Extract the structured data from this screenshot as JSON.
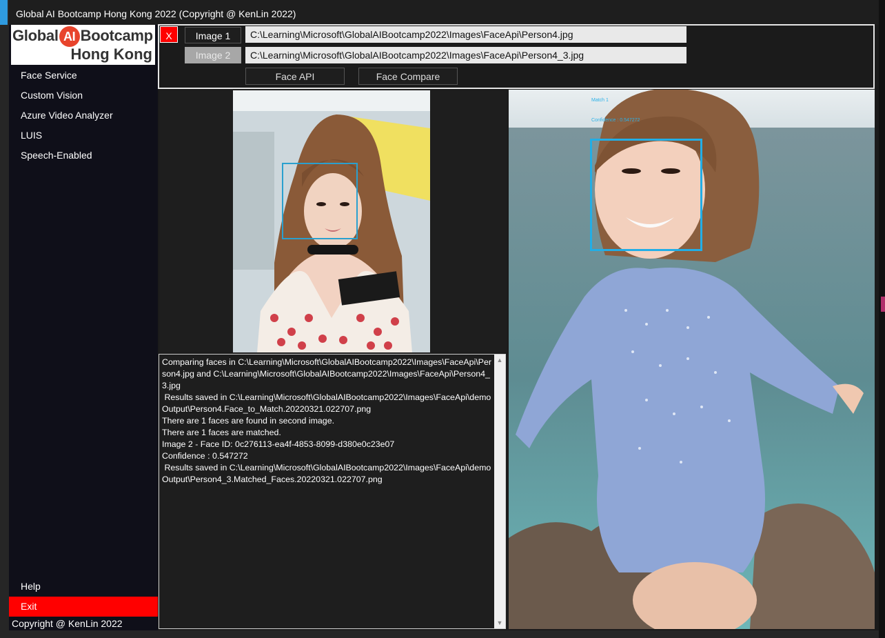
{
  "window": {
    "title": "Global AI Bootcamp Hong Kong 2022 (Copyright @ KenLin 2022)"
  },
  "logo": {
    "word1": "Global",
    "ai": "AI",
    "word2": "Bootcamp",
    "line2": "Hong Kong"
  },
  "sidebar": {
    "items": [
      {
        "label": "Face Service"
      },
      {
        "label": "Custom Vision"
      },
      {
        "label": "Azure Video Analyzer"
      },
      {
        "label": "LUIS"
      },
      {
        "label": "Speech-Enabled"
      }
    ],
    "help_label": "Help",
    "exit_label": "Exit",
    "copyright": "Copyright @ KenLin 2022"
  },
  "toolbar": {
    "close_label": "X",
    "image1_label": "Image 1",
    "image2_label": "Image 2",
    "image1_path": "C:\\Learning\\Microsoft\\GlobalAIBootcamp2022\\Images\\FaceApi\\Person4.jpg",
    "image2_path": "C:\\Learning\\Microsoft\\GlobalAIBootcamp2022\\Images\\FaceApi\\Person4_3.jpg",
    "face_api_label": "Face API",
    "face_compare_label": "Face Compare"
  },
  "result_overlay": {
    "match_label": "Match 1",
    "confidence_label": "Confidence : 0.547272"
  },
  "log": {
    "text": "Comparing faces in C:\\Learning\\Microsoft\\GlobalAIBootcamp2022\\Images\\FaceApi\\Person4.jpg and C:\\Learning\\Microsoft\\GlobalAIBootcamp2022\\Images\\FaceApi\\Person4_3.jpg\n Results saved in C:\\Learning\\Microsoft\\GlobalAIBootcamp2022\\Images\\FaceApi\\demoOutput\\Person4.Face_to_Match.20220321.022707.png\nThere are 1 faces are found in second image.\nThere are 1 faces are matched.\nImage 2 - Face ID: 0c276113-ea4f-4853-8099-d380e0c23e07\nConfidence : 0.547272\n Results saved in C:\\Learning\\Microsoft\\GlobalAIBootcamp2022\\Images\\FaceApi\\demoOutput\\Person4_3.Matched_Faces.20220321.022707.png"
  },
  "colors": {
    "accent": "#2f9be0",
    "exit_red": "#ff0000",
    "face_box": "#22aee6"
  }
}
